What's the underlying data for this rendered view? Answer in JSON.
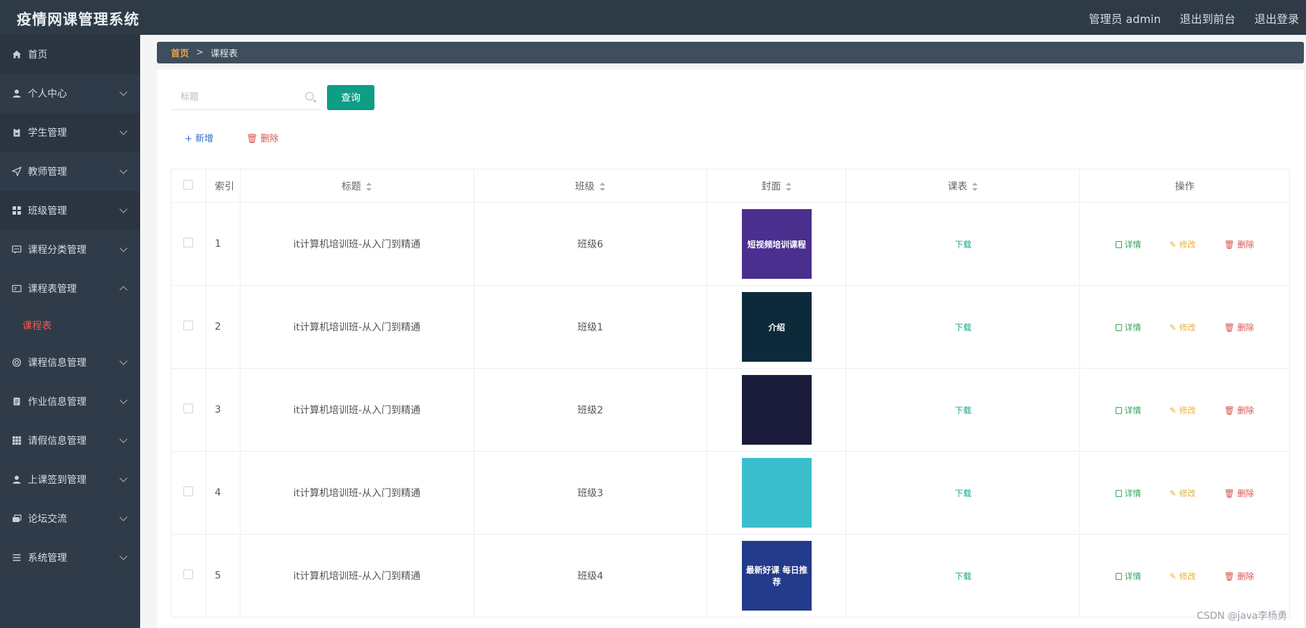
{
  "header": {
    "title": "疫情网课管理系统",
    "user": "管理员 admin",
    "to_front": "退出到前台",
    "logout": "退出登录"
  },
  "sidebar": {
    "items": [
      {
        "label": "首页",
        "icon": "home-icon"
      },
      {
        "label": "个人中心",
        "icon": "user-icon"
      },
      {
        "label": "学生管理",
        "icon": "clipboard-icon"
      },
      {
        "label": "教师管理",
        "icon": "send-icon"
      },
      {
        "label": "班级管理",
        "icon": "grid-icon"
      },
      {
        "label": "课程分类管理",
        "icon": "chat-icon"
      },
      {
        "label": "课程表管理",
        "icon": "card-icon",
        "expanded": true
      },
      {
        "label": "课程信息管理",
        "icon": "circle-icon"
      },
      {
        "label": "作业信息管理",
        "icon": "doc-icon"
      },
      {
        "label": "请假信息管理",
        "icon": "apps-icon"
      },
      {
        "label": "上课签到管理",
        "icon": "user-icon"
      },
      {
        "label": "论坛交流",
        "icon": "forum-icon"
      },
      {
        "label": "系统管理",
        "icon": "menu-icon"
      }
    ],
    "sub_active": "课程表"
  },
  "breadcrumb": {
    "home": "首页",
    "sep": ">",
    "current": "课程表"
  },
  "search": {
    "placeholder": "标题",
    "value": "",
    "query_button": "查询"
  },
  "actions": {
    "add": "新增",
    "delete": "删除"
  },
  "table": {
    "headers": [
      "索引",
      "标题",
      "班级",
      "封面",
      "课表",
      "操作"
    ],
    "download_label": "下载",
    "op_detail": "详情",
    "op_edit": "修改",
    "op_delete": "删除",
    "rows": [
      {
        "index": "1",
        "title": "it计算机培训班-从入门到精通",
        "class": "班级6",
        "cover_text": "短视频培训课程",
        "cover_color": "#4a2f8f"
      },
      {
        "index": "2",
        "title": "it计算机培训班-从入门到精通",
        "class": "班级1",
        "cover_text": "介绍",
        "cover_color": "#0d2a3a"
      },
      {
        "index": "3",
        "title": "it计算机培训班-从入门到精通",
        "class": "班级2",
        "cover_text": "",
        "cover_color": "#1a1a3a"
      },
      {
        "index": "4",
        "title": "it计算机培训班-从入门到精通",
        "class": "班级3",
        "cover_text": "",
        "cover_color": "#3bbfcf"
      },
      {
        "index": "5",
        "title": "it计算机培训班-从入门到精通",
        "class": "班级4",
        "cover_text": "最新好课 每日推荐",
        "cover_color": "#243a8a"
      }
    ]
  },
  "watermark": "CSDN @java李杨勇"
}
